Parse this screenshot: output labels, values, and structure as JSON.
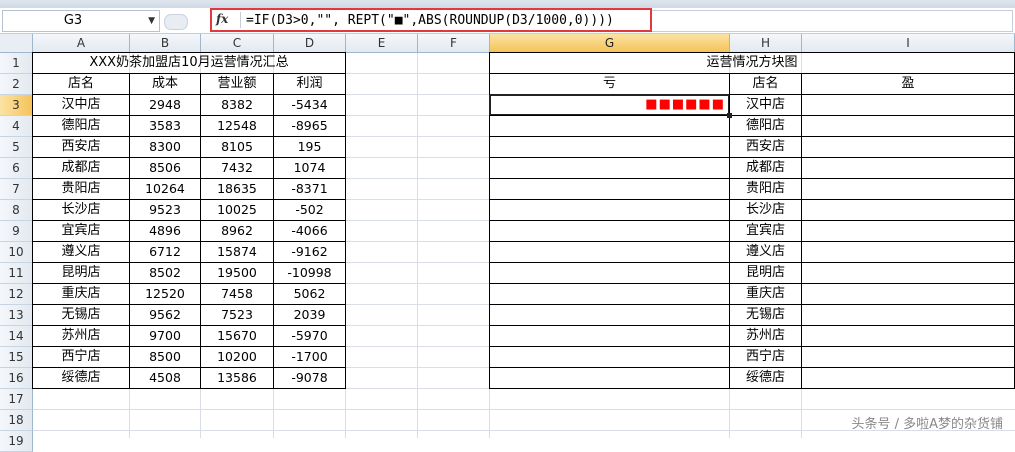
{
  "name_box": "G3",
  "formula": "=IF(D3>0,\"\", REPT(\"■\",ABS(ROUNDUP(D3/1000,0))))",
  "columns": [
    "A",
    "B",
    "C",
    "D",
    "E",
    "F",
    "G",
    "H",
    "I"
  ],
  "rows": [
    "1",
    "2",
    "3",
    "4",
    "5",
    "6",
    "7",
    "8",
    "9",
    "10",
    "11",
    "12",
    "13",
    "14",
    "15",
    "16",
    "17",
    "18",
    "19"
  ],
  "table1": {
    "title": "XXX奶茶加盟店10月运营情况汇总",
    "headers": [
      "店名",
      "成本",
      "营业额",
      "利润"
    ],
    "rows": [
      [
        "汉中店",
        "2948",
        "8382",
        "-5434"
      ],
      [
        "德阳店",
        "3583",
        "12548",
        "-8965"
      ],
      [
        "西安店",
        "8300",
        "8105",
        "195"
      ],
      [
        "成都店",
        "8506",
        "7432",
        "1074"
      ],
      [
        "贵阳店",
        "10264",
        "18635",
        "-8371"
      ],
      [
        "长沙店",
        "9523",
        "10025",
        "-502"
      ],
      [
        "宜宾店",
        "4896",
        "8962",
        "-4066"
      ],
      [
        "遵义店",
        "6712",
        "15874",
        "-9162"
      ],
      [
        "昆明店",
        "8502",
        "19500",
        "-10998"
      ],
      [
        "重庆店",
        "12520",
        "7458",
        "5062"
      ],
      [
        "无锡店",
        "9562",
        "7523",
        "2039"
      ],
      [
        "苏州店",
        "9700",
        "15670",
        "-5970"
      ],
      [
        "西宁店",
        "8500",
        "10200",
        "-1700"
      ],
      [
        "绥德店",
        "4508",
        "13586",
        "-9078"
      ]
    ]
  },
  "table2": {
    "title": "运营情况方块图",
    "header_loss": "亏",
    "header_store": "店名",
    "header_profit": "盈",
    "g3_blocks": "■■■■■■",
    "stores": [
      "汉中店",
      "德阳店",
      "西安店",
      "成都店",
      "贵阳店",
      "长沙店",
      "宜宾店",
      "遵义店",
      "昆明店",
      "重庆店",
      "无锡店",
      "苏州店",
      "西宁店",
      "绥德店"
    ]
  },
  "watermark": "头条号 / 多啦A梦的杂货铺",
  "colors": {
    "accent_red": "#e0393e",
    "block_red": "#ff0000",
    "selected_header": "#f5c35a"
  }
}
